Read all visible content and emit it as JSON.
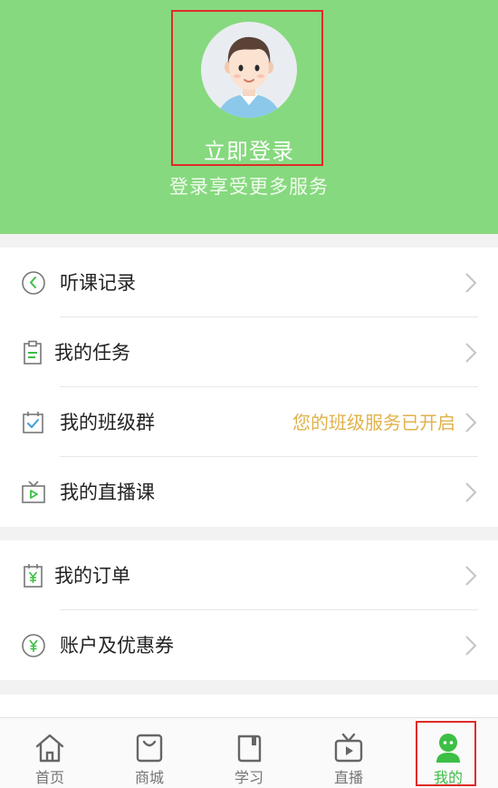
{
  "colors": {
    "header_green": "#86d97e",
    "accent_green": "#3cbf45",
    "hint_gold": "#e1b24a",
    "highlight_red": "#e02b27"
  },
  "header": {
    "login_title": "立即登录",
    "login_subtitle": "登录享受更多服务",
    "avatar_icon": "avatar-icon"
  },
  "menu_group_1": [
    {
      "label": "听课记录",
      "icon": "history-icon"
    },
    {
      "label": "我的任务",
      "icon": "clipboard-icon"
    },
    {
      "label": "我的班级群",
      "icon": "calendar-check-icon",
      "hint": "您的班级服务已开启"
    },
    {
      "label": "我的直播课",
      "icon": "tv-play-icon"
    }
  ],
  "menu_group_2": [
    {
      "label": "我的订单",
      "icon": "order-yen-icon"
    },
    {
      "label": "账户及优惠券",
      "icon": "coin-yen-icon"
    }
  ],
  "tabbar": [
    {
      "label": "首页",
      "icon": "home-icon",
      "active": false
    },
    {
      "label": "商城",
      "icon": "shopping-bag-icon",
      "active": false
    },
    {
      "label": "学习",
      "icon": "book-icon",
      "active": false
    },
    {
      "label": "直播",
      "icon": "tv-play-icon",
      "active": false
    },
    {
      "label": "我的",
      "icon": "user-icon",
      "active": true
    }
  ]
}
